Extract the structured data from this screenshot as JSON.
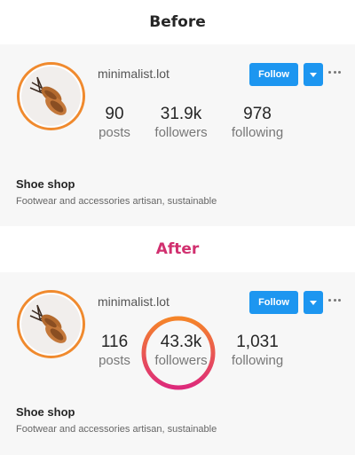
{
  "before": {
    "heading": "Before",
    "profile": {
      "username": "minimalist.lot",
      "follow_label": "Follow",
      "stats": {
        "posts": {
          "value": "90",
          "label": "posts"
        },
        "followers": {
          "value": "31.9k",
          "label": "followers"
        },
        "following": {
          "value": "978",
          "label": "following"
        }
      },
      "bio_name": "Shoe shop",
      "bio_desc": "Footwear and accessories artisan, sustainable"
    }
  },
  "after": {
    "heading": "After",
    "profile": {
      "username": "minimalist.lot",
      "follow_label": "Follow",
      "stats": {
        "posts": {
          "value": "116",
          "label": "posts"
        },
        "followers": {
          "value": "43.3k",
          "label": "followers"
        },
        "following": {
          "value": "1,031",
          "label": "following"
        }
      },
      "bio_name": "Shoe shop",
      "bio_desc": "Footwear and accessories artisan, sustainable"
    }
  },
  "colors": {
    "follow_button": "#1d96f0",
    "avatar_ring": "#f08a2e",
    "after_heading": "#d1306f",
    "highlight_start": "#f58529",
    "highlight_end": "#dd2a7b"
  },
  "icons": {
    "avatar": "shoe-photo",
    "dropdown": "caret-down-icon",
    "more": "ellipsis-icon"
  }
}
